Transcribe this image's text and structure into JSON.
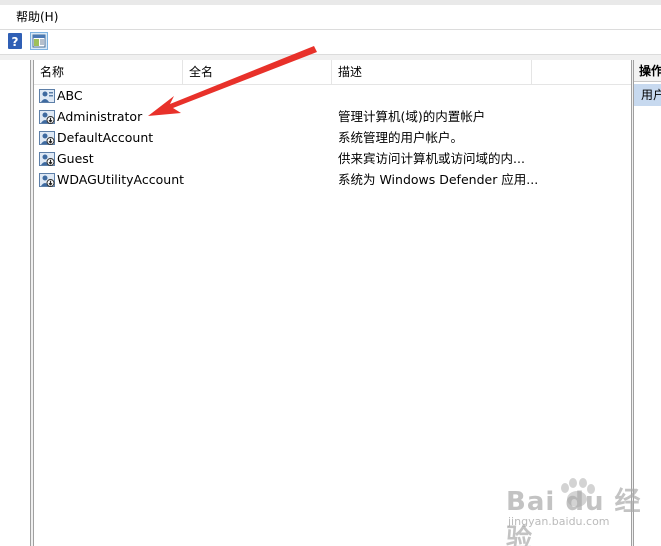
{
  "menubar": {
    "help_label": "帮助(H)"
  },
  "toolbar": {
    "help_icon": "help-question-icon",
    "panel_icon": "show-hide-action-pane-icon"
  },
  "columns": {
    "name": "名称",
    "fullname": "全名",
    "description": "描述"
  },
  "users": [
    {
      "name": "ABC",
      "description": ""
    },
    {
      "name": "Administrator",
      "description": "管理计算机(域)的内置帐户"
    },
    {
      "name": "DefaultAccount",
      "description": "系统管理的用户帐户。"
    },
    {
      "name": "Guest",
      "description": "供来宾访问计算机或访问域的内..."
    },
    {
      "name": "WDAGUtilityAccount",
      "description": "系统为 Windows Defender 应用..."
    }
  ],
  "actions": {
    "header": "操作",
    "item": "用户"
  },
  "colors": {
    "arrow": "#e8312a",
    "selection": "#c7d9ef"
  },
  "watermark": {
    "brand": "Bai du 经验",
    "url": "jingyan.baidu.com"
  }
}
